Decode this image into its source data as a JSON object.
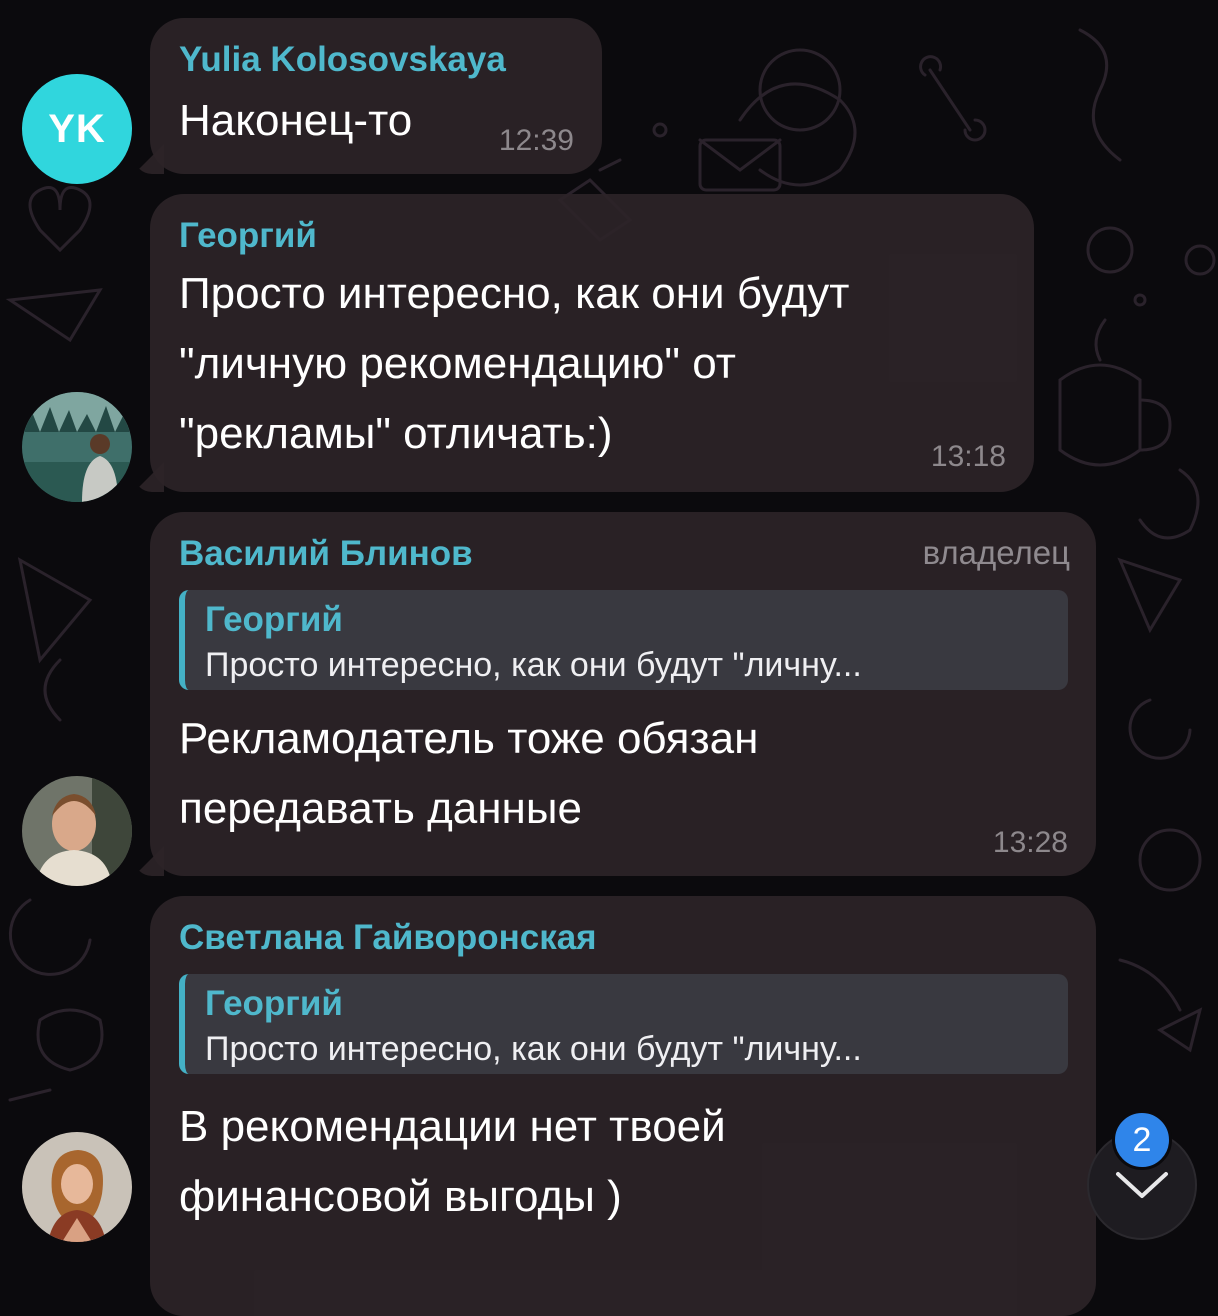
{
  "messages": [
    {
      "sender": "Yulia Kolosovskaya",
      "sender_color": "#4fb8cc",
      "avatar_initials": "YK",
      "text": "Наконец-то",
      "time": "12:39"
    },
    {
      "sender": "Георгий",
      "sender_color": "#4fb8cc",
      "text": "Просто интересно, как они будут\n\"личную рекомендацию\" от\n\"рекламы\" отличать:)",
      "time": "13:18"
    },
    {
      "sender": "Василий Блинов",
      "sender_color": "#4fb8cc",
      "role": "владелец",
      "reply": {
        "name": "Георгий",
        "text": "Просто интересно, как они будут \"личну..."
      },
      "text": "Рекламодатель тоже обязан\nпередавать данные",
      "time": "13:28"
    },
    {
      "sender": "Светлана Гайворонская",
      "sender_color": "#4fb8cc",
      "reply": {
        "name": "Георгий",
        "text": "Просто интересно, как они будут \"личну..."
      },
      "text": "В рекомендации нет твоей\nфинансовой выгоды )"
    }
  ],
  "scroll_down": {
    "icon": "chevron-down-icon",
    "unread_count": "2",
    "badge_color": "#2f85ea"
  }
}
